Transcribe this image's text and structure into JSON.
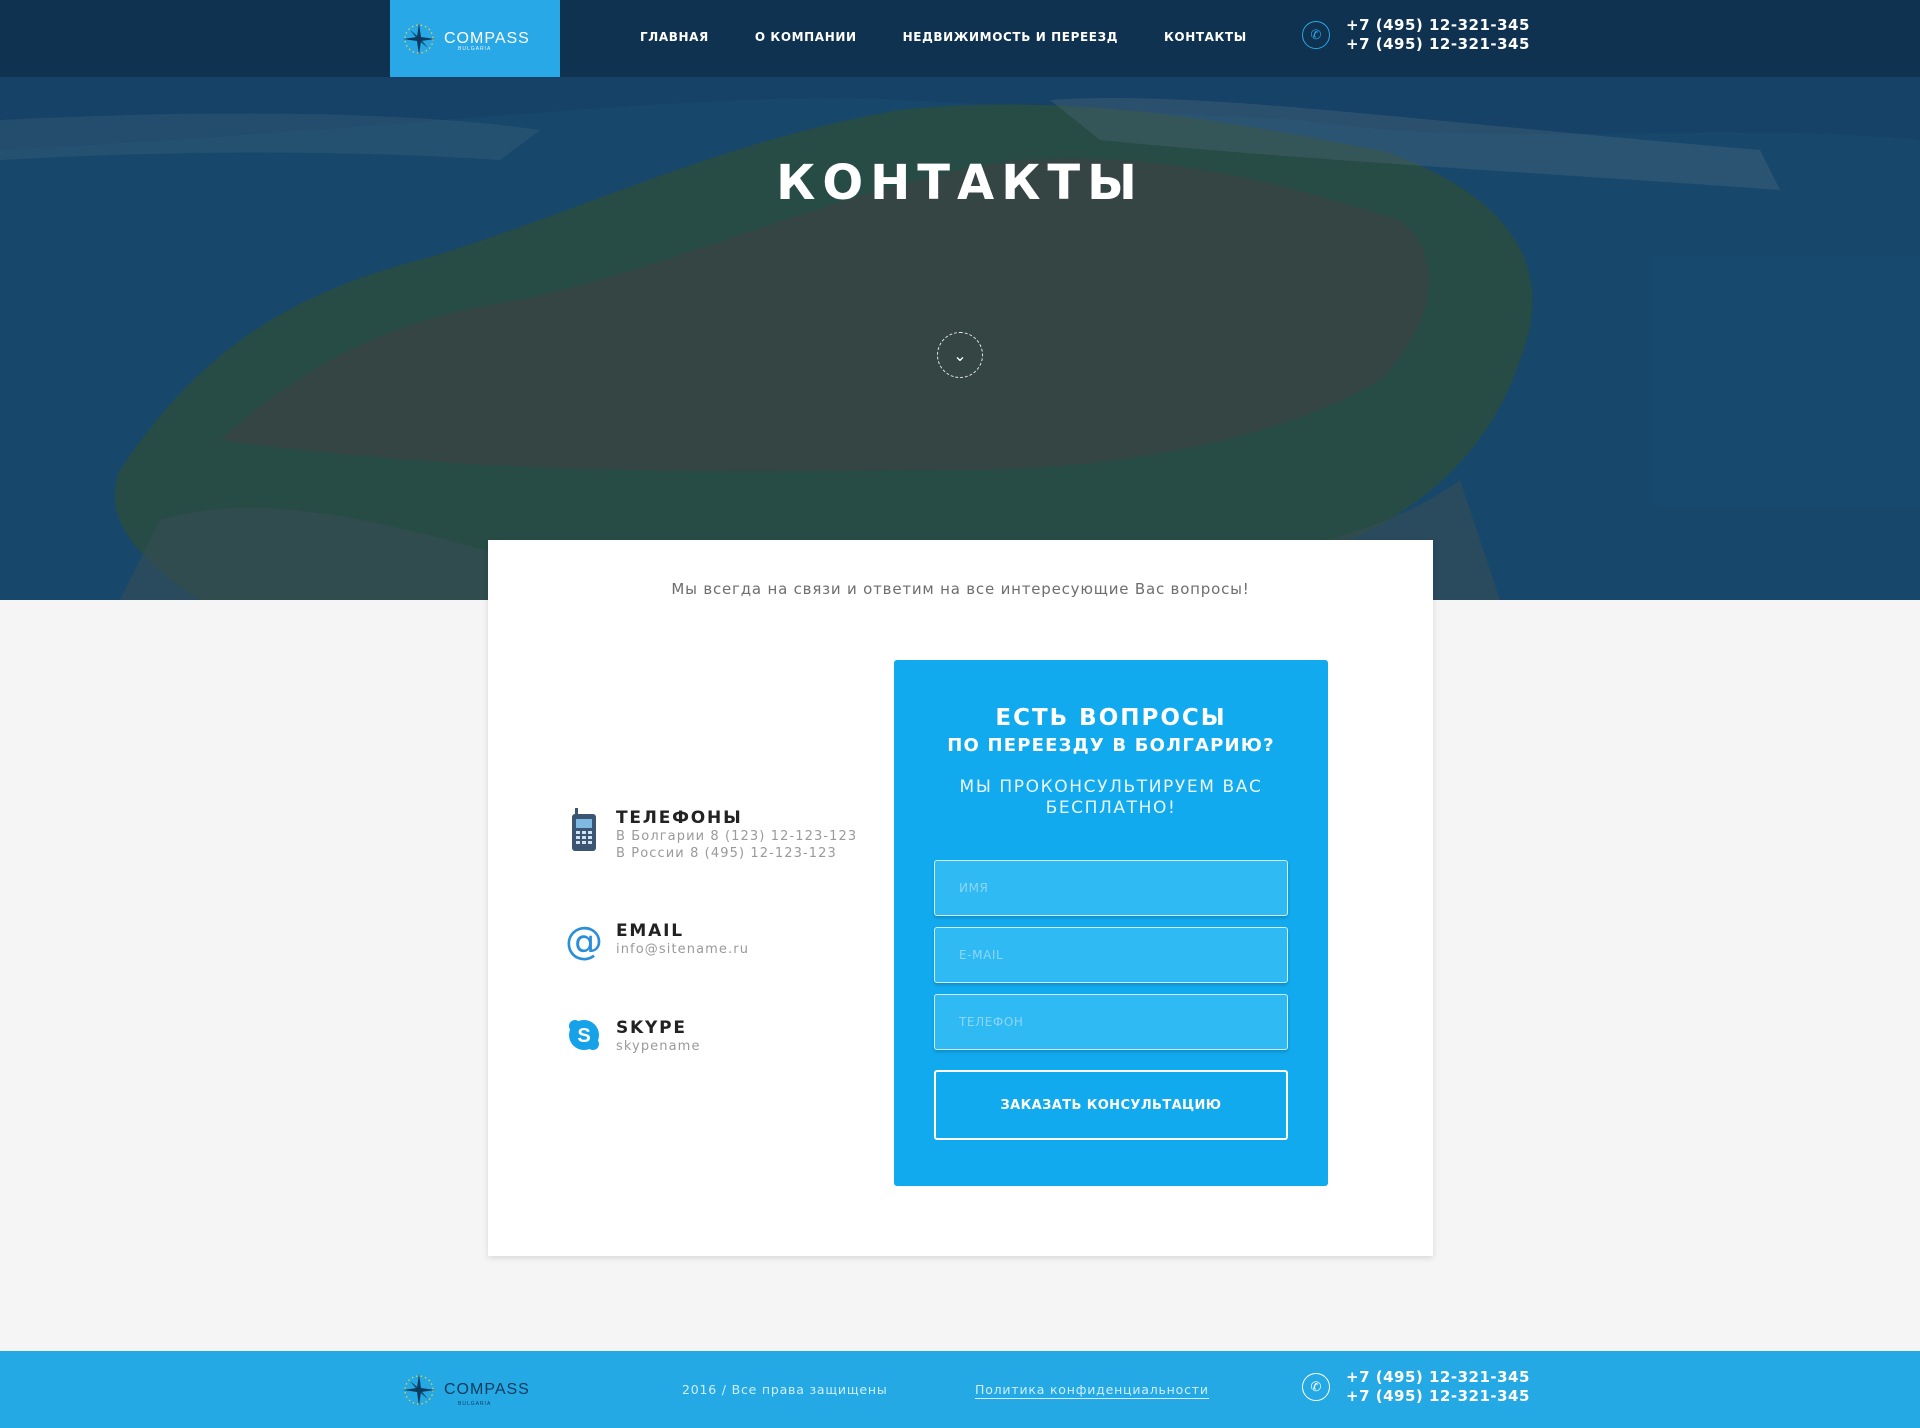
{
  "header": {
    "logo": {
      "name": "COMPASS",
      "tagline": "BULGARIA"
    },
    "nav": [
      "ГЛАВНАЯ",
      "О КОМПАНИИ",
      "НЕДВИЖИМОСТЬ И ПЕРЕЕЗД",
      "КОНТАКТЫ"
    ],
    "phones": [
      "+7 (495) 12-321-345",
      "+7 (495) 12-321-345"
    ]
  },
  "hero": {
    "title": "КОНТАКТЫ"
  },
  "intro": "Мы всегда на связи и ответим на все интересующие Вас вопросы!",
  "contacts": {
    "phones": {
      "title": "ТЕЛЕФОНЫ",
      "lines": [
        "В Болгарии 8 (123) 12-123-123",
        "В России 8 (495) 12-123-123"
      ],
      "icon": "mobile-phone-icon"
    },
    "email": {
      "title": "EMAIL",
      "value": "info@sitename.ru",
      "icon": "at-sign-icon"
    },
    "skype": {
      "title": "SKYPE",
      "value": "skypename",
      "icon": "skype-icon"
    }
  },
  "form": {
    "heading_1": "ЕСТЬ ВОПРОСЫ",
    "heading_2": "ПО ПЕРЕЕЗДУ В БОЛГАРИЮ?",
    "subheading": "МЫ ПРОКОНСУЛЬТИРУЕМ ВАС БЕСПЛАТНО!",
    "name_placeholder": "ИМЯ",
    "email_placeholder": "E-MAIL",
    "phone_placeholder": "ТЕЛЕФОН",
    "submit_label": "ЗАКАЗАТЬ КОНСУЛЬТАЦИЮ"
  },
  "footer": {
    "logo": {
      "name": "COMPASS",
      "tagline": "BULGARIA"
    },
    "copyright": "2016 / Все права защищены",
    "policy": "Политика конфиденциальности",
    "phones": [
      "+7 (495) 12-321-345",
      "+7 (495) 12-321-345"
    ]
  },
  "colors": {
    "accent": "#12aaee",
    "footer": "#25a9e4",
    "logo_bg": "#29a8e8",
    "page_bg": "#f5f5f5"
  }
}
